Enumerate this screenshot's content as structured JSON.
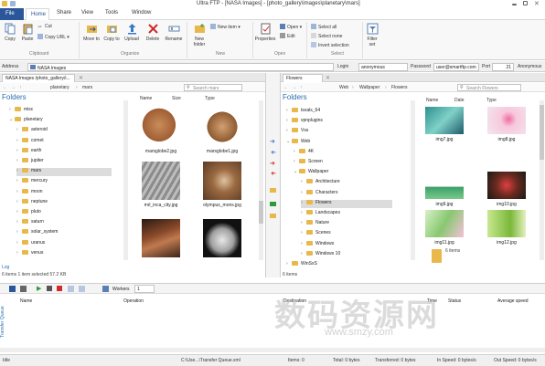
{
  "titlebar": {
    "title": "Ultra FTP - [NASA Images] - [photo_gallery\\images\\planetary\\mars]"
  },
  "ribbon_tabs": [
    "File",
    "Home",
    "Share",
    "View",
    "Tools",
    "Window"
  ],
  "ribbon": {
    "copy": "Copy",
    "paste": "Paste",
    "cut": "Cut",
    "copy_url": "Copy URL",
    "move_to": "Move to",
    "copy_to": "Copy to",
    "upload": "Upload",
    "delete": "Delete",
    "rename": "Rename",
    "new_folder": "New folder",
    "new_item": "New item",
    "properties": "Properties",
    "open": "Open",
    "edit": "Edit",
    "select_all": "Select all",
    "select_none": "Select none",
    "invert_selection": "Invert selection",
    "filter_set": "Filter set",
    "groups": [
      "Clipboard",
      "Organize",
      "New",
      "Open",
      "Select"
    ]
  },
  "address": {
    "label": "Address",
    "value": "NASA Images",
    "login_label": "Login",
    "login_value": "anonymous",
    "password_label": "Password",
    "password_value": "user@smartftp.com",
    "port_label": "Port",
    "port_value": "21",
    "anon_label": "Anonymous"
  },
  "left_pane": {
    "tab": "NASA Images",
    "path_tab": "/photo_gallery/i...",
    "breadcrumb": [
      "planetary",
      "mars"
    ],
    "search_placeholder": "Search mars",
    "folders_title": "Folders",
    "tree": [
      "misc",
      "planetary",
      "asteroid",
      "comet",
      "earth",
      "jupiter",
      "mars",
      "mercury",
      "moon",
      "neptune",
      "pluto",
      "saturn",
      "solar_system",
      "uranus",
      "venus"
    ],
    "columns": [
      "Name",
      "Size",
      "Type"
    ],
    "files": [
      "marsglobe2.jpg",
      "marsglobe1.jpg",
      "mrl_inca_city.jpg",
      "olympus_mons.jpg",
      "",
      ""
    ],
    "log_label": "Log",
    "status": "6 items    1 item selected  57.2 KB"
  },
  "right_pane": {
    "tab": "Flowers",
    "breadcrumb": [
      "Web",
      "Wallpaper",
      "Flowers"
    ],
    "search_placeholder": "Search Flowers",
    "folders_title": "Folders",
    "tree": [
      "tsvals_64",
      "vpnplugins",
      "Vss",
      "Web",
      "4K",
      "Screen",
      "Wallpaper",
      "Architecture",
      "Characters",
      "Flowers",
      "Landscapes",
      "Nature",
      "Scenes",
      "Windows",
      "Windows 10",
      "WinSxS"
    ],
    "columns": [
      "Name",
      "Date",
      "Type"
    ],
    "files": [
      "img7.jpg",
      "img8.jpg",
      "img9.jpg",
      "img10.jpg",
      "img11.jpg",
      "img12.jpg"
    ],
    "drive_label": "6 items",
    "status": "6 items"
  },
  "queue": {
    "side_label": "Transfer Queue",
    "workers_label": "Workers",
    "workers_value": "1",
    "columns": [
      "Name",
      "Operation",
      "Destination",
      "Time",
      "Status",
      "Average speed"
    ]
  },
  "statusbar": {
    "left": "Idle",
    "path": "C:\\Use...\\Transfer Queue.xml",
    "items": "Items: 0",
    "total": "Total: 0 bytes",
    "transferred": "Transferred: 0 bytes",
    "in_speed": "In Speed: 0 bytes/s",
    "out_speed": "Out Speed: 0 bytes/s"
  },
  "watermark": {
    "text": "数码资源网",
    "url": "www.smzy.com"
  },
  "colors": {
    "accent": "#2b579a",
    "folder": "#e8b84a",
    "link_blue": "#2b6cb0"
  }
}
